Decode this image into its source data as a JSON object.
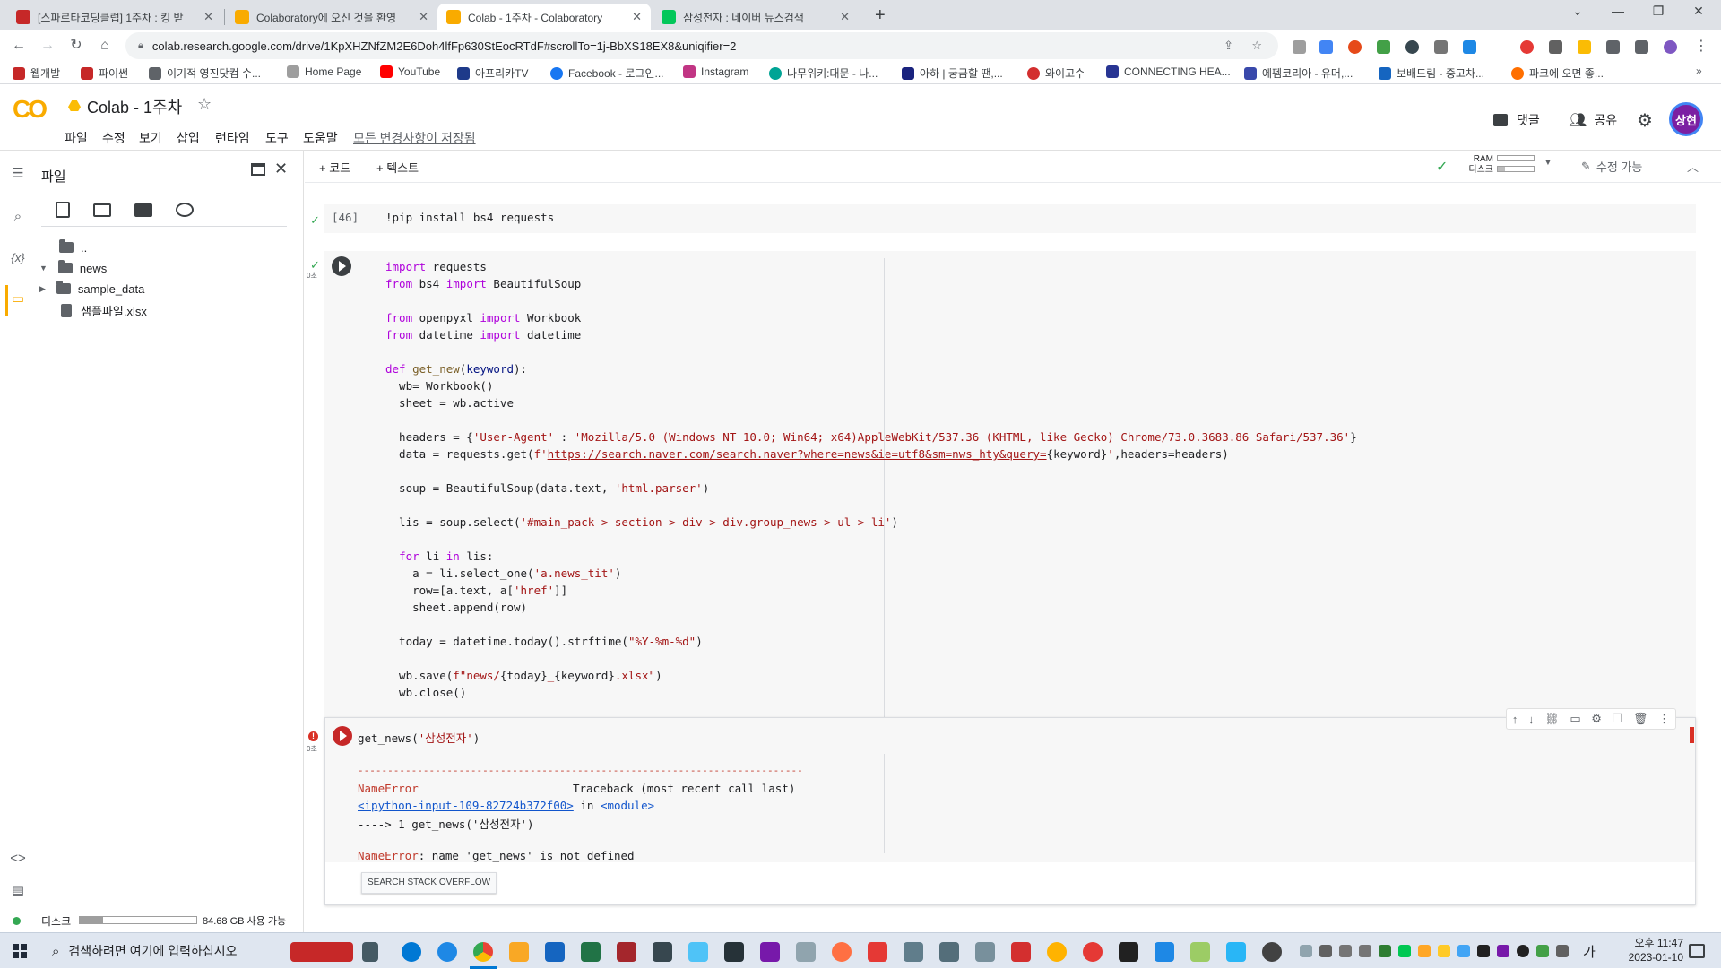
{
  "browser": {
    "tabs": [
      {
        "title": "[스파르타코딩클럽] 1주차 : 킹 받",
        "favicon_color": "#c62828"
      },
      {
        "title": "Colaboratory에 오신 것을 환영",
        "favicon_color": "#f9ab00"
      },
      {
        "title": "Colab - 1주차 - Colaboratory",
        "favicon_color": "#f9ab00",
        "active": true
      },
      {
        "title": "삼성전자 : 네이버 뉴스검색",
        "favicon_color": "#03c75a"
      }
    ],
    "url": "colab.research.google.com/drive/1KpXHZNfZM2E6Doh4lfFp630StEocRTdF#scrollTo=1j-BbXS18EX8&uniqifier=2",
    "bookmarks": [
      {
        "label": "웹개발",
        "color": "#c62828"
      },
      {
        "label": "파이썬",
        "color": "#c62828"
      },
      {
        "label": "이기적 영진닷컴 수...",
        "color": "#5f6368"
      },
      {
        "label": "Home Page",
        "color": "#9e9e9e"
      },
      {
        "label": "YouTube",
        "color": "#ff0000"
      },
      {
        "label": "아프리카TV",
        "color": "#1e3a8a"
      },
      {
        "label": "Facebook - 로그인...",
        "color": "#1877f2"
      },
      {
        "label": "Instagram",
        "color": "#c13584"
      },
      {
        "label": "나무위키:대문 - 나...",
        "color": "#00a495"
      },
      {
        "label": "아하 | 궁금할 땐,...",
        "color": "#1a237e"
      },
      {
        "label": "와이고수",
        "color": "#d32f2f"
      },
      {
        "label": "CONNECTING HEA...",
        "color": "#283593"
      },
      {
        "label": "에펨코리아 - 유머,...",
        "color": "#3949ab"
      },
      {
        "label": "보배드림 - 중고차...",
        "color": "#1565c0"
      },
      {
        "label": "파크에 오면 좋...",
        "color": "#ff6f00"
      }
    ],
    "window_controls": [
      "⌄",
      "—",
      "❐",
      "✕"
    ]
  },
  "colab": {
    "logo": "CO",
    "title": "Colab - 1주차",
    "menu": [
      "파일",
      "수정",
      "보기",
      "삽입",
      "런타임",
      "도구",
      "도움말"
    ],
    "saved_status": "모든 변경사항이 저장됨",
    "comment_label": "댓글",
    "share_label": "공유",
    "avatar_label": "상현",
    "add_code": "+ 코드",
    "add_text": "+ 텍스트",
    "ram_label": "RAM",
    "disk_label": "디스크",
    "edit_label": "수정 가능"
  },
  "sidebar": {
    "title": "파일",
    "tree": [
      {
        "name": "..",
        "type": "up"
      },
      {
        "name": "news",
        "type": "folder",
        "expanded": true
      },
      {
        "name": "sample_data",
        "type": "folder",
        "expanded": false
      },
      {
        "name": "샘플파일.xlsx",
        "type": "file"
      }
    ],
    "disk_label": "디스크",
    "disk_usage": "84.68 GB 사용 가능",
    "disk_used_fraction": 0.2
  },
  "cells": {
    "cell1": {
      "exec": "[46]",
      "source": "!pip install bs4 requests"
    },
    "cell2_time": "0초",
    "cell3_time": "0초",
    "cell3_source_pre": "get_news(",
    "cell3_source_str": "'삼성전자'",
    "cell3_source_post": ")",
    "output": {
      "dashes": "---------------------------------------------------------------------------",
      "error_name": "NameError",
      "traceback_label": "Traceback (most recent call last)",
      "input_link": "<ipython-input-109-82724b372f00>",
      "in_text": " in ",
      "module_text": "<module>",
      "arrow_line": "----> 1 get_news('삼성전자')",
      "error_line_msg": ": name 'get_news' is not defined",
      "so_button": "SEARCH STACK OVERFLOW"
    }
  },
  "taskbar": {
    "search_placeholder": "검색하려면 여기에 입력하십시오",
    "time": "오후 11:47",
    "date": "2023-01-10",
    "ime": "가"
  }
}
